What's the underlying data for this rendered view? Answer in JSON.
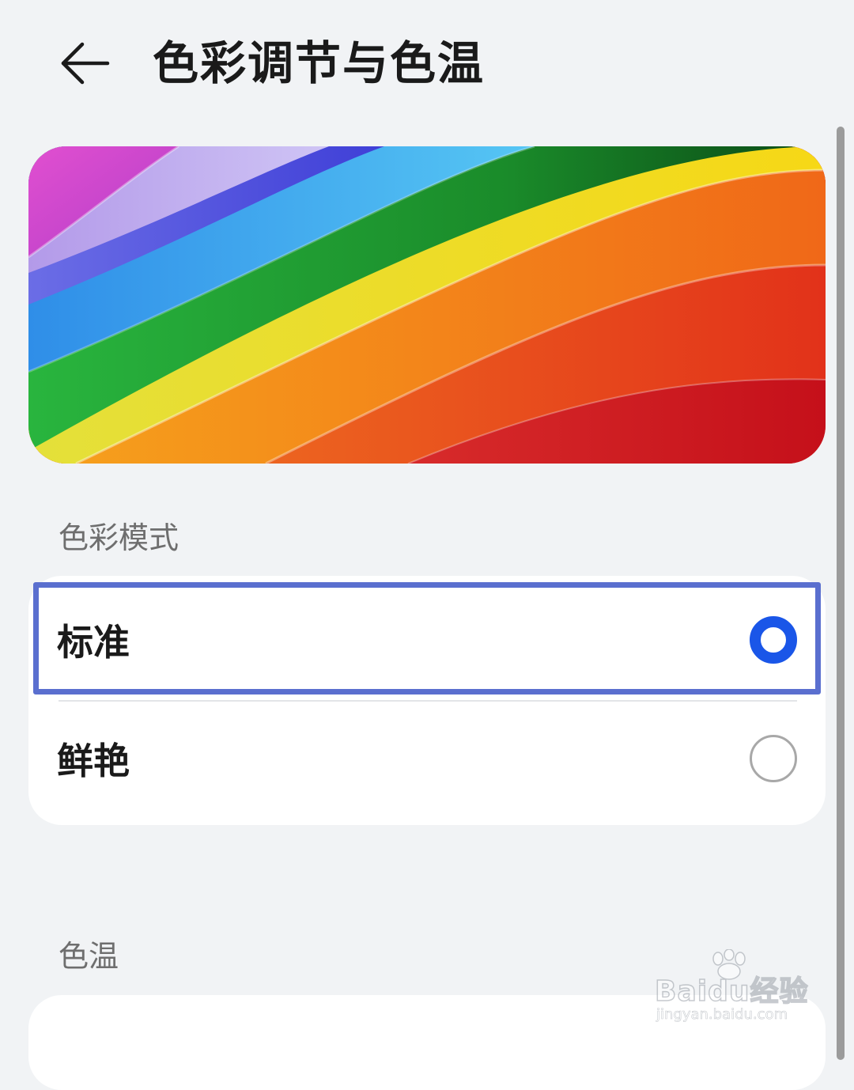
{
  "header": {
    "title": "色彩调节与色温",
    "back_icon": "arrow-left-icon"
  },
  "preview": {
    "description_icon": "rainbow-preview-image"
  },
  "color_mode": {
    "section_label": "色彩模式",
    "options": [
      {
        "label": "标准",
        "selected": true
      },
      {
        "label": "鲜艳",
        "selected": false
      }
    ]
  },
  "color_temperature": {
    "section_label": "色温"
  },
  "colors": {
    "background": "#f1f3f5",
    "card": "#ffffff",
    "accent": "#1a56e8",
    "highlight_frame": "#5a6fcf",
    "section_label": "#6e6e6e"
  },
  "watermark": {
    "logo": "Baidu经验",
    "url": "jingyan.baidu.com"
  }
}
